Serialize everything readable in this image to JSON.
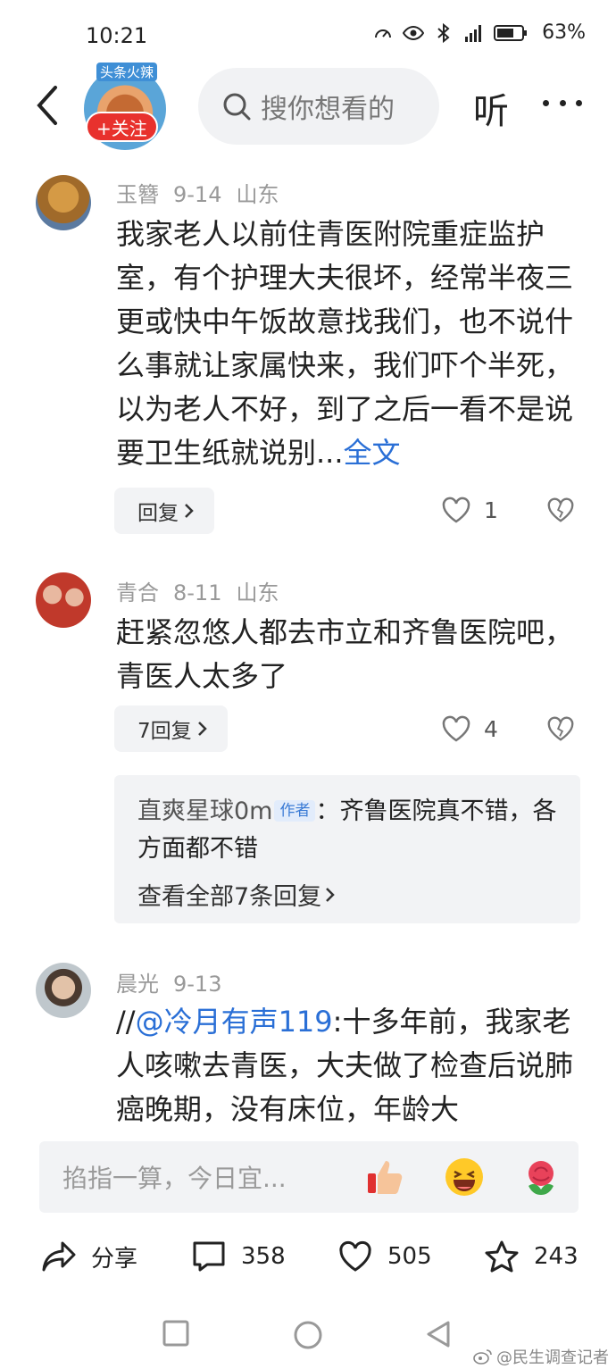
{
  "status_bar": {
    "time": "10:21",
    "battery": "63%"
  },
  "header": {
    "account_tag": "头条火辣",
    "follow_label": "+关注",
    "search_placeholder": "搜你想看的",
    "listen_label": "听"
  },
  "comments": [
    {
      "author": "玉簪",
      "date": "9-14",
      "location": "山东",
      "text": "我家老人以前住青医附院重症监护室，有个护理大夫很坏，经常半夜三更或快中午饭故意找我们，也不说什么事就让家属快来，我们吓个半死，以为老人不好，到了之后一看不是说要卫生纸就说别...",
      "more_label": "全文",
      "reply_label": "回复",
      "likes": "1"
    },
    {
      "author": "青合",
      "date": "8-11",
      "location": "山东",
      "text": "赶紧忽悠人都去市立和齐鲁医院吧，青医人太多了",
      "reply_label": "7回复",
      "likes": "4",
      "sub_reply": {
        "author": "直爽星球0m",
        "badge": "作者",
        "text": "：齐鲁医院真不错，各方面都不错",
        "view_all": "查看全部7条回复"
      }
    },
    {
      "author": "晨光",
      "date": "9-13",
      "prefix": "//",
      "mention": "@冷月有声119",
      "text": ":十多年前，我家老人咳嗽去青医，大夫做了检查后说肺癌晚期，没有床位，年龄大"
    }
  ],
  "input_bar": {
    "placeholder": "掐指一算，今日宜..."
  },
  "actions": {
    "share_label": "分享",
    "comments_count": "358",
    "likes_count": "505",
    "favorites_count": "243"
  },
  "watermark": "@民生调查记者",
  "colors": {
    "accent_red": "#e8312d",
    "link_blue": "#2a6fd6"
  }
}
